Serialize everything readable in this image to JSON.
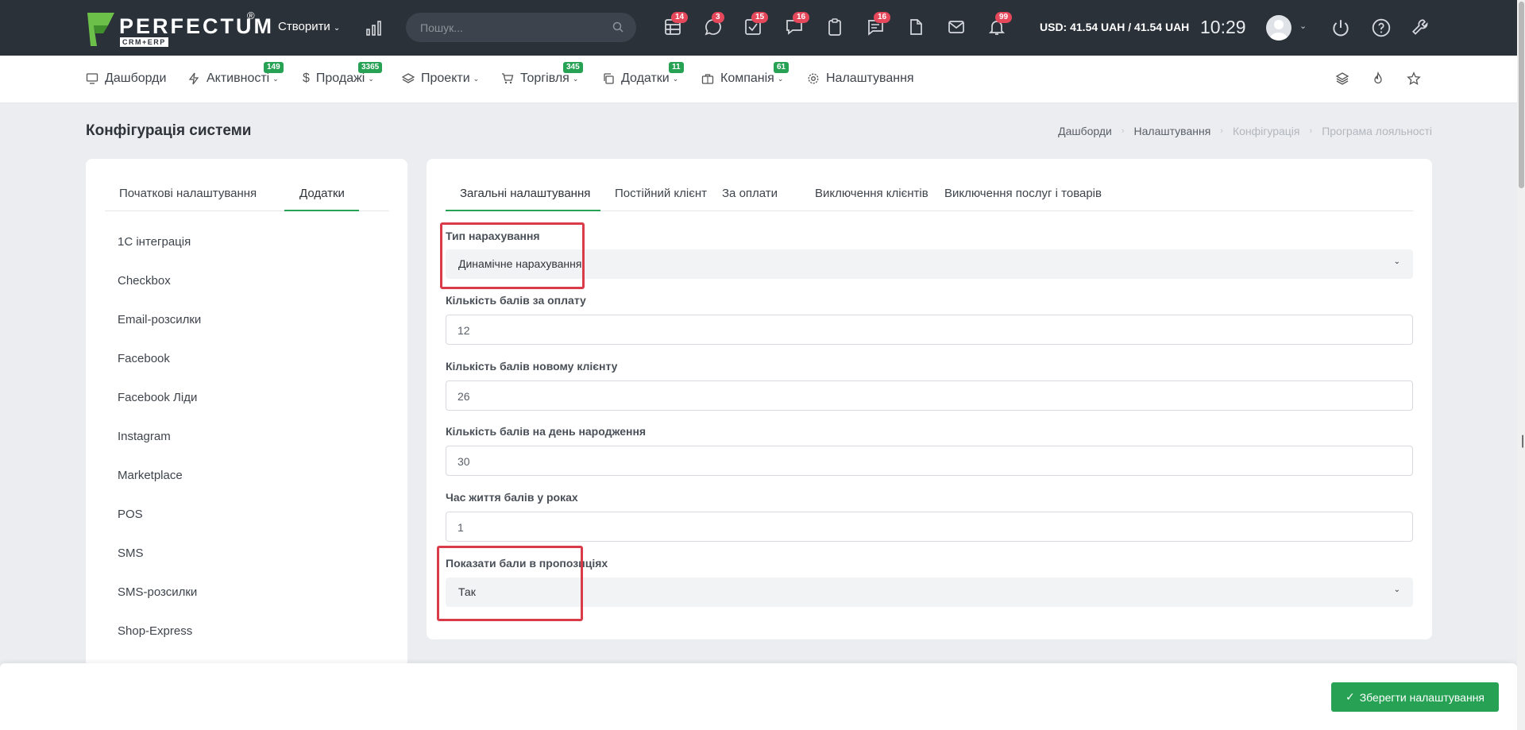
{
  "brand": {
    "name": "PERFECTUM",
    "reg": "®",
    "sub": "CRM+ERP"
  },
  "topbar": {
    "create_label": "Створити",
    "search_placeholder": "Пошук...",
    "icons": [
      {
        "name": "task-list-icon",
        "badge": "14"
      },
      {
        "name": "chat-bubble-icon",
        "badge": "3"
      },
      {
        "name": "checkbox-icon",
        "badge": "15"
      },
      {
        "name": "messages-icon",
        "badge": "16"
      },
      {
        "name": "clipboard-icon",
        "badge": ""
      },
      {
        "name": "notes-icon",
        "badge": "16"
      },
      {
        "name": "file-icon",
        "badge": ""
      },
      {
        "name": "mail-icon",
        "badge": ""
      },
      {
        "name": "bell-icon",
        "badge": "99"
      }
    ],
    "rates": "USD: 41.54 UAH / 41.54 UAH",
    "time": "10:29"
  },
  "nav": {
    "items": [
      {
        "label": "Дашборди",
        "badge": ""
      },
      {
        "label": "Активності",
        "badge": "149"
      },
      {
        "label": "Продажі",
        "badge": "3365"
      },
      {
        "label": "Проекти",
        "badge": ""
      },
      {
        "label": "Торгівля",
        "badge": "345"
      },
      {
        "label": "Додатки",
        "badge": "11"
      },
      {
        "label": "Компанія",
        "badge": "61"
      },
      {
        "label": "Налаштування",
        "badge": ""
      }
    ]
  },
  "page": {
    "title": "Конфігурація системи",
    "breadcrumb": [
      "Дашборди",
      "Налаштування",
      "Конфігурація",
      "Програма лояльності"
    ]
  },
  "sidebar": {
    "tabs": [
      "Початкові налаштування",
      "Додатки"
    ],
    "items": [
      "1С інтеграція",
      "Checkbox",
      "Email-розсилки",
      "Facebook",
      "Facebook Ліди",
      "Instagram",
      "Marketplace",
      "POS",
      "SMS",
      "SMS-розсилки",
      "Shop-Express"
    ]
  },
  "main": {
    "tabs": [
      "Загальні налаштування",
      "Постійний клієнт",
      "За оплати",
      "Виключення клієнтів",
      "Виключення послуг і товарів"
    ],
    "fields": {
      "accrual_type": {
        "label": "Тип нарахування",
        "value": "Динамічне нарахування"
      },
      "points_payment": {
        "label": "Кількість балів за оплату",
        "value": "12"
      },
      "points_new_client": {
        "label": "Кількість балів новому клієнту",
        "value": "26"
      },
      "points_birthday": {
        "label": "Кількість балів на день народження",
        "value": "30"
      },
      "points_lifetime": {
        "label": "Час життя балів у роках",
        "value": "1"
      },
      "show_points": {
        "label": "Показати бали в пропозиціях",
        "value": "Так"
      }
    }
  },
  "footer": {
    "save_label": "Зберегти налаштування"
  }
}
